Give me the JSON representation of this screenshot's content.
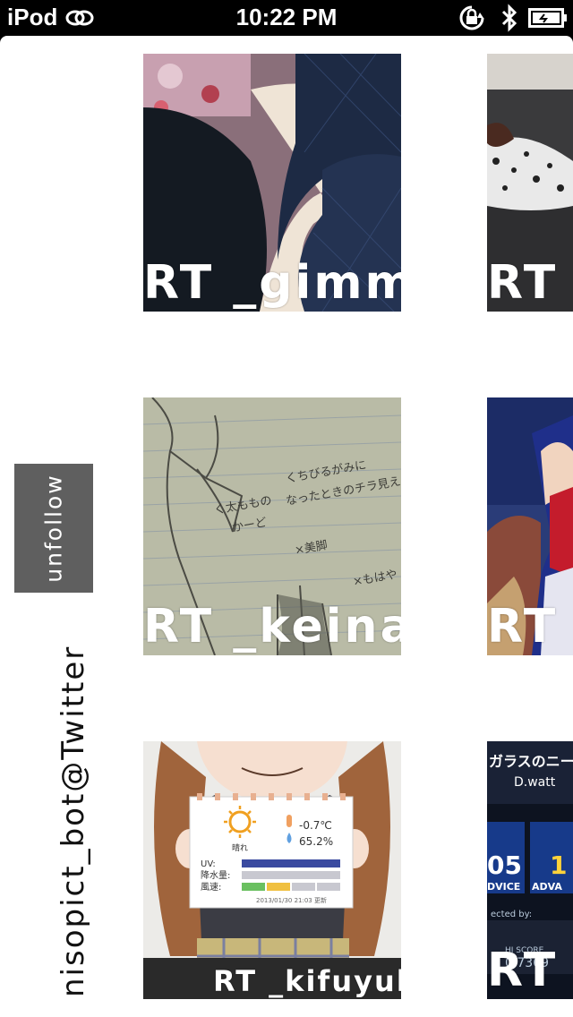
{
  "status_bar": {
    "device": "iPod",
    "time": "10:22 PM"
  },
  "sidebar": {
    "unfollow_label": "unfollow",
    "account_label": "nisopict_bot@Twitter"
  },
  "tiles": [
    {
      "caption": "RT _gimm"
    },
    {
      "caption": "RT _"
    },
    {
      "caption": "RT _keina("
    },
    {
      "caption": "RT _"
    },
    {
      "caption": "RT _kifuyuki"
    },
    {
      "caption": "RT _"
    }
  ],
  "weather_card": {
    "condition": "晴れ",
    "temperature": "-0.7℃",
    "humidity": "65.2%",
    "uv_label": "UV:",
    "precip_label": "降水量:",
    "wind_label": "風速:",
    "updated": "2013/01/30 21:03 更新"
  },
  "notebook_text": {
    "line1": "くちびるがみに",
    "line2": "なったときのチラ見え",
    "line3": "く太ももの",
    "line4": "かーど",
    "line5": "×美脚",
    "line6": "×もはや"
  },
  "game_screen": {
    "title": "ガラスのニーソ",
    "subtitle": "D.watt",
    "left_number": "05",
    "left_badge": "DVICE",
    "right_number": "1",
    "right_badge": "ADVA",
    "footer1": "ected by:",
    "footer2": "HI SCORE",
    "footer3": "0 7369"
  }
}
